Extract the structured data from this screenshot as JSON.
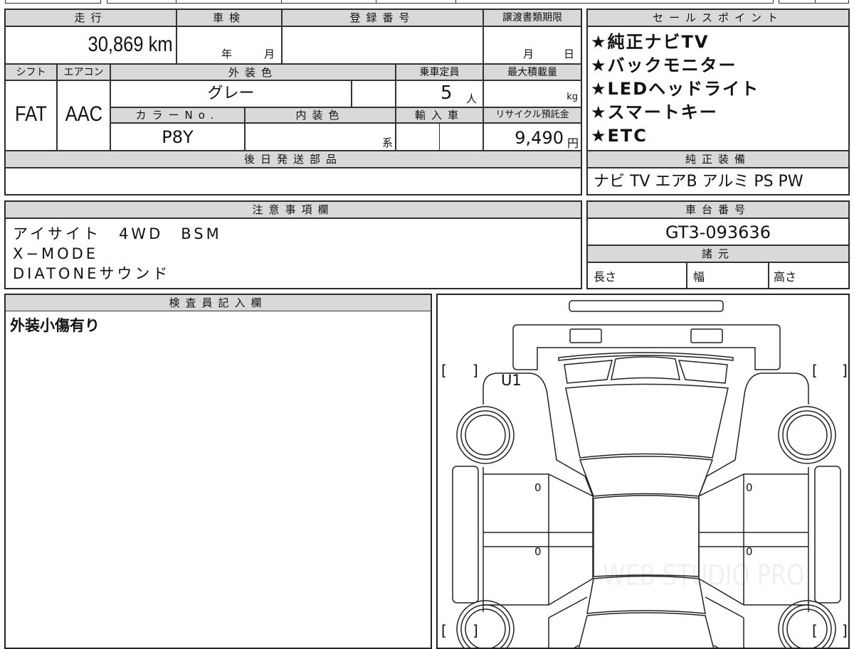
{
  "headers": {
    "mileage": "走行",
    "inspection": "車検",
    "registration_no": "登録番号",
    "transfer_deadline": "譲渡書類期限",
    "shift": "シフト",
    "aircon": "エアコン",
    "exterior_color": "外装色",
    "capacity": "乗車定員",
    "max_load": "最大積載量",
    "color_no": "カラーNo.",
    "interior_color": "内装色",
    "imported": "輸入車",
    "recycle_fee": "リサイクル預託金",
    "later_parts": "後日発送部品",
    "sales_points": "セールスポイント",
    "genuine_equipment": "純正装備",
    "notes": "注意事項欄",
    "chassis_no": "車台番号",
    "specs": "諸元",
    "inspector_notes": "検査員記入欄"
  },
  "values": {
    "mileage": "30,869 km",
    "inspection_year_unit": "年",
    "inspection_month_unit": "月",
    "deadline_month_unit": "月",
    "deadline_day_unit": "日",
    "shift": "FAT",
    "aircon": "AAC",
    "exterior_color": "グレー",
    "capacity_num": "5",
    "capacity_unit": "人",
    "max_load_unit": "kg",
    "color_no": "P8Y",
    "interior_color_suffix": "系",
    "recycle_fee_num": "9,490",
    "recycle_fee_unit": "円",
    "genuine_equipment": "ナビ TV エアB アルミ PS PW",
    "chassis_no": "GT3-093636",
    "spec_length": "長さ",
    "spec_width": "幅",
    "spec_height": "高さ",
    "inspector_notes": "外装小傷有り"
  },
  "sales_points": [
    "★純正ナビTV",
    "★バックモニター",
    "★LEDヘッドライト",
    "★スマートキー",
    "★ETC"
  ],
  "notes_lines": [
    "アイサイト　4WD　BSM",
    "X−MODE",
    "DIATONEサウンド"
  ],
  "diagram": {
    "damage_code": "U1",
    "door_marks": [
      "0",
      "0",
      "0",
      "0"
    ],
    "bracket_open": "[",
    "bracket_close": "]",
    "watermark": "WEB STUDIO PRO"
  }
}
